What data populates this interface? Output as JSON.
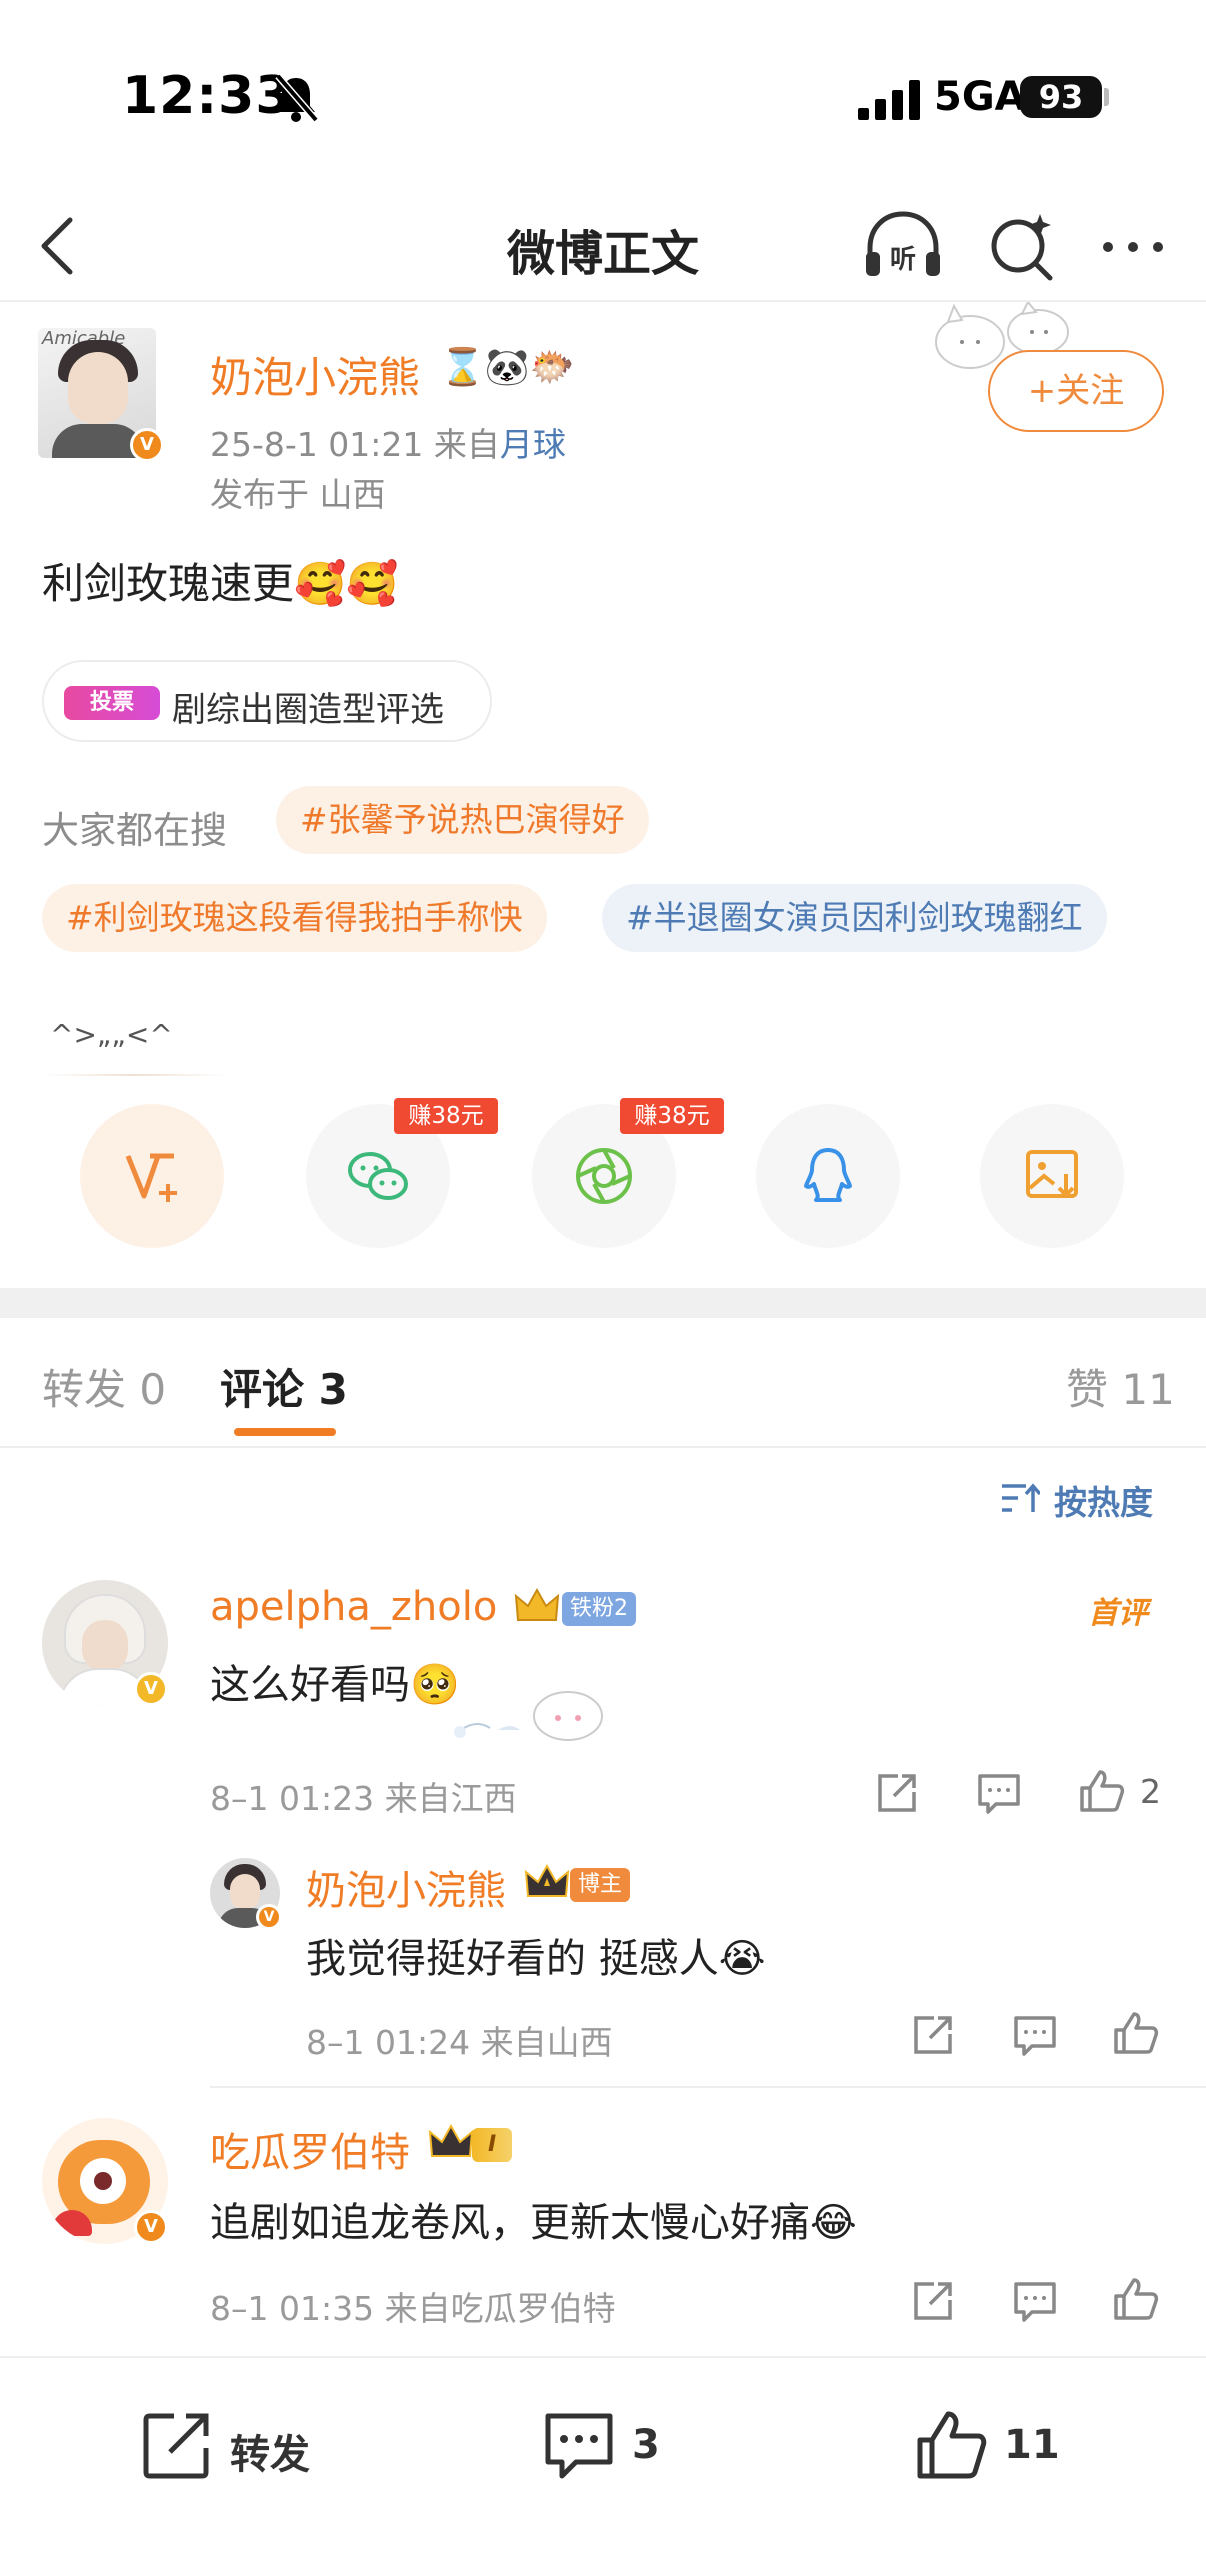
{
  "status_bar": {
    "time": "12:33",
    "network": "5GA",
    "battery": "93"
  },
  "nav": {
    "title": "微博正文",
    "listen_label": "听"
  },
  "author": {
    "name": "奶泡小浣熊",
    "emojis": "⌛🐼🐡",
    "time": "25-8-1 01:21",
    "from_prefix": "来自",
    "source": "月球",
    "location": "发布于 山西",
    "avatar_text": "Amicable",
    "follow_label": "+关注"
  },
  "post": {
    "text": "利剑玫瑰速更🥰🥰",
    "vote_badge": "投票",
    "vote_label": "剧综出圈造型评选",
    "search_lead": "大家都在搜",
    "tags": [
      "#张馨予说热巴演得好",
      "#利剑玫瑰这段看得我拍手称快",
      "#半退圈女演员因利剑玫瑰翻红"
    ]
  },
  "share": {
    "tooltip": "^>„„<^",
    "reward_wechat": "赚38元",
    "reward_moments": "赚38元"
  },
  "tabs": {
    "repost": "转发 0",
    "comments": "评论 3",
    "likes": "赞 11",
    "sort": "按热度"
  },
  "comments": [
    {
      "name": "apelpha_zholo",
      "badge": "铁粉2",
      "tag": "首评",
      "text": "这么好看吗🥺",
      "meta": "8–1 01:23  来自江西",
      "likes": "2"
    },
    {
      "name": "奶泡小浣熊",
      "badge": "博主",
      "text": "我觉得挺好看的 挺感人😭",
      "meta": "8–1 01:24  来自山西"
    },
    {
      "name": "吃瓜罗伯特",
      "badge": "I",
      "text": "追剧如追龙卷风，更新太慢心好痛😂",
      "meta": "8–1 01:35  来自吃瓜罗伯特"
    }
  ],
  "bottom_bar": {
    "repost": "转发",
    "comments": "3",
    "likes": "11"
  },
  "colors": {
    "accent": "#f07c26",
    "link": "#4f7bb4",
    "meta": "#9a9a9a"
  }
}
